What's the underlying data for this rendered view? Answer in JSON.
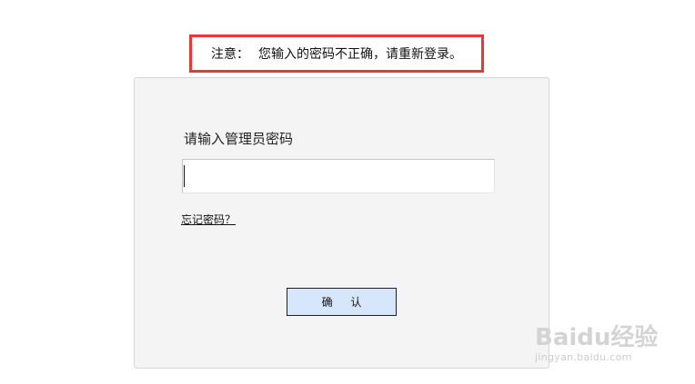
{
  "alert": {
    "label": "注意：",
    "message": "您输入的密码不正确，请重新登录。",
    "border_color": "#e53935"
  },
  "login_panel": {
    "prompt": "请输入管理员密码",
    "password_value": "",
    "forgot_link": "忘记密码？",
    "confirm_button": "确 认",
    "button_bg": "#d7e7fb"
  },
  "watermark": {
    "brand": "Baidu经验",
    "url": "jingyan.baidu.com"
  }
}
